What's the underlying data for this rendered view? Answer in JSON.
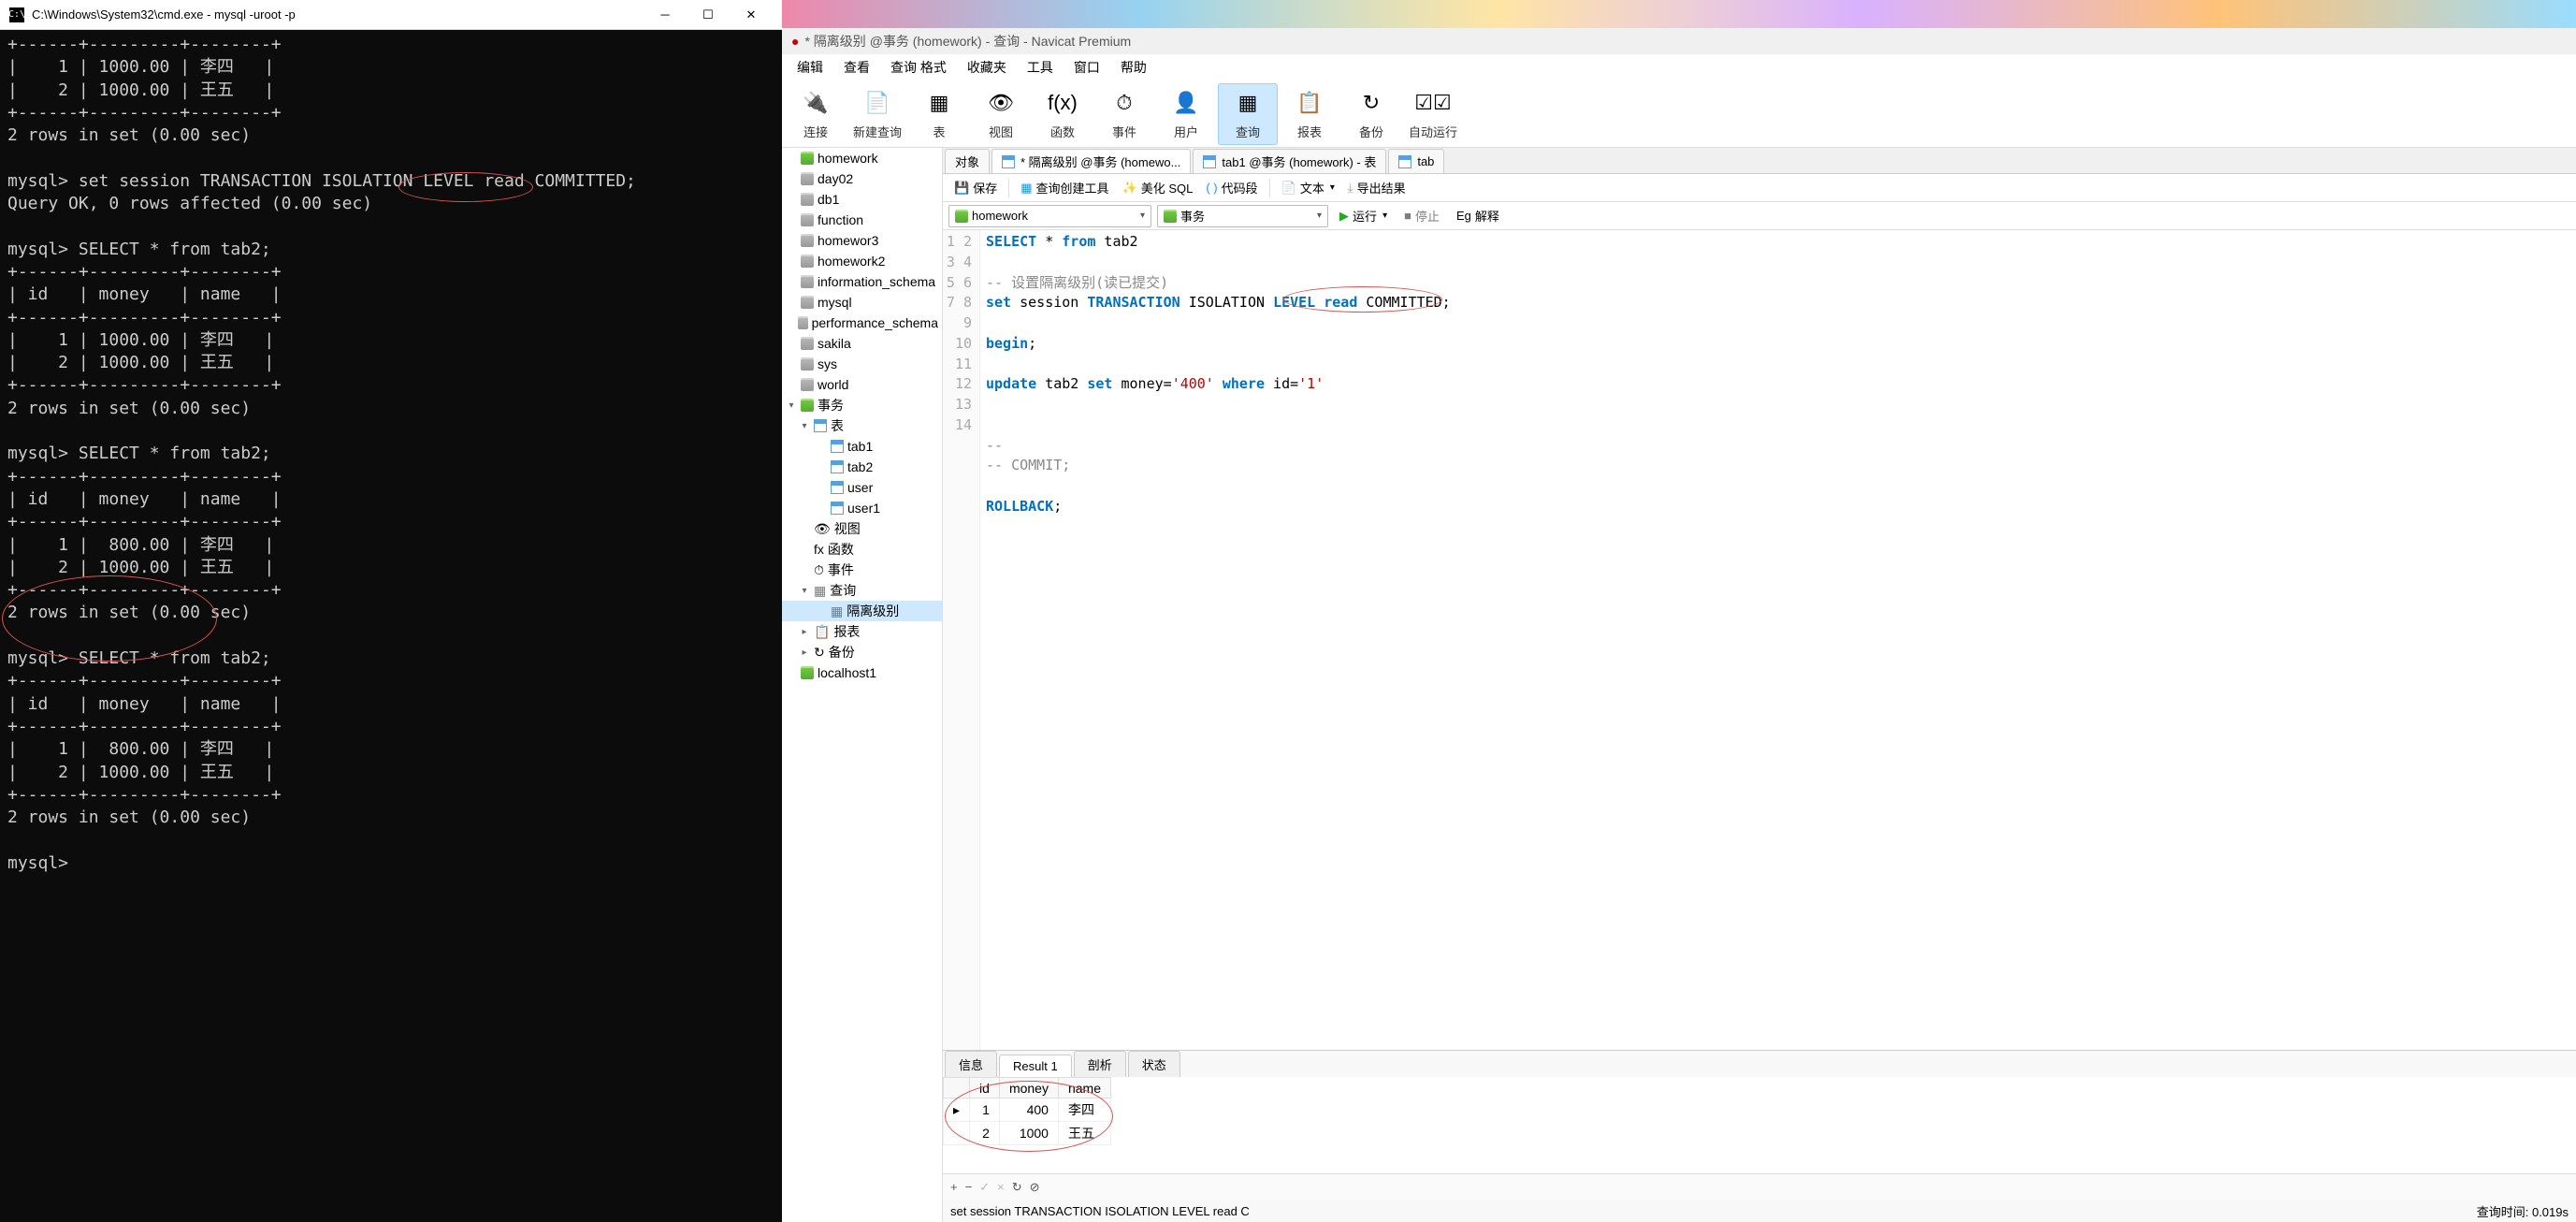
{
  "cmd": {
    "title": "C:\\Windows\\System32\\cmd.exe - mysql  -uroot -p",
    "output": "+------+---------+--------+\n|    1 | 1000.00 | 李四   |\n|    2 | 1000.00 | 王五   |\n+------+---------+--------+\n2 rows in set (0.00 sec)\n\nmysql> set session TRANSACTION ISOLATION LEVEL read COMMITTED;\nQuery OK, 0 rows affected (0.00 sec)\n\nmysql> SELECT * from tab2;\n+------+---------+--------+\n| id   | money   | name   |\n+------+---------+--------+\n|    1 | 1000.00 | 李四   |\n|    2 | 1000.00 | 王五   |\n+------+---------+--------+\n2 rows in set (0.00 sec)\n\nmysql> SELECT * from tab2;\n+------+---------+--------+\n| id   | money   | name   |\n+------+---------+--------+\n|    1 |  800.00 | 李四   |\n|    2 | 1000.00 | 王五   |\n+------+---------+--------+\n2 rows in set (0.00 sec)\n\nmysql> SELECT * from tab2;\n+------+---------+--------+\n| id   | money   | name   |\n+------+---------+--------+\n|    1 |  800.00 | 李四   |\n|    2 | 1000.00 | 王五   |\n+------+---------+--------+\n2 rows in set (0.00 sec)\n\nmysql> "
  },
  "navicat": {
    "title": "* 隔离级别 @事务 (homework) - 查询 - Navicat Premium",
    "menu": [
      "编辑",
      "查看",
      "查询 格式",
      "收藏夹",
      "工具",
      "窗口",
      "帮助"
    ],
    "toolbar": [
      {
        "label": "连接",
        "icon": "🔌"
      },
      {
        "label": "新建查询",
        "icon": "📄"
      },
      {
        "label": "表",
        "icon": "▦"
      },
      {
        "label": "视图",
        "icon": "👁"
      },
      {
        "label": "函数",
        "icon": "f(x)"
      },
      {
        "label": "事件",
        "icon": "⏱"
      },
      {
        "label": "用户",
        "icon": "👤"
      },
      {
        "label": "查询",
        "icon": "▦",
        "sel": true
      },
      {
        "label": "报表",
        "icon": "📋"
      },
      {
        "label": "备份",
        "icon": "↻"
      },
      {
        "label": "自动运行",
        "icon": "☑☑"
      }
    ],
    "sidebar_top": [
      {
        "label": "homework",
        "type": "db-green"
      },
      {
        "label": "day02",
        "type": "db"
      },
      {
        "label": "db1",
        "type": "db"
      },
      {
        "label": "function",
        "type": "db"
      },
      {
        "label": "homewor3",
        "type": "db"
      },
      {
        "label": "homework2",
        "type": "db"
      },
      {
        "label": "information_schema",
        "type": "db"
      },
      {
        "label": "mysql",
        "type": "db"
      },
      {
        "label": "performance_schema",
        "type": "db"
      },
      {
        "label": "sakila",
        "type": "db"
      },
      {
        "label": "sys",
        "type": "db"
      },
      {
        "label": "world",
        "type": "db"
      }
    ],
    "sidebar_shiwu": "事务",
    "sidebar_table_hdr": "表",
    "sidebar_tables": [
      "tab1",
      "tab2",
      "user",
      "user1"
    ],
    "sidebar_extra": [
      {
        "label": "视图",
        "icon": "👁"
      },
      {
        "label": "函数",
        "icon": "fx"
      },
      {
        "label": "事件",
        "icon": "⏱"
      }
    ],
    "sidebar_query_hdr": "查询",
    "sidebar_query_item": "隔离级别",
    "sidebar_bottom": [
      {
        "label": "报表",
        "icon": "📋"
      },
      {
        "label": "备份",
        "icon": "↻"
      }
    ],
    "sidebar_localhost": "localhost1",
    "tabs": [
      {
        "label": "对象",
        "active": false
      },
      {
        "label": "* 隔离级别 @事务 (homewo...",
        "active": true
      },
      {
        "label": "tab1 @事务 (homework) - 表",
        "active": false
      },
      {
        "label": "tab",
        "active": false
      }
    ],
    "subtoolbar": {
      "save": "保存",
      "qbuilder": "查询创建工具",
      "beautify": "美化 SQL",
      "snippet": "代码段",
      "text": "文本",
      "export": "导出结果"
    },
    "combo_db": "homework",
    "combo_schema": "事务",
    "run": "运行",
    "stop": "停止",
    "explain": "解释",
    "sql_lines": [
      {
        "n": 1,
        "html": "<span class='kw'>SELECT</span> * <span class='kw'>from</span> tab2"
      },
      {
        "n": 2,
        "html": ""
      },
      {
        "n": 3,
        "html": "<span class='gray'>-- 设置隔离级别(读已提交)</span>"
      },
      {
        "n": 4,
        "html": "<span class='kw'>set</span> session <span class='kw'>TRANSACTION</span> ISOLATION <span class='kw'>LEVEL</span> <span class='kw'>read</span> COMMITTED;"
      },
      {
        "n": 5,
        "html": ""
      },
      {
        "n": 6,
        "html": "<span class='kw'>begin</span>;"
      },
      {
        "n": 7,
        "html": ""
      },
      {
        "n": 8,
        "html": "<span class='kw'>update</span> tab2 <span class='kw'>set</span> money=<span class='str'>'400'</span> <span class='kw'>where</span> id=<span class='str'>'1'</span>"
      },
      {
        "n": 9,
        "html": ""
      },
      {
        "n": 10,
        "html": ""
      },
      {
        "n": 11,
        "html": "<span class='gray'>-- </span>"
      },
      {
        "n": 12,
        "html": "<span class='gray'>-- COMMIT;</span>"
      },
      {
        "n": 13,
        "html": ""
      },
      {
        "n": 14,
        "html": "<span class='kw'>ROLLBACK</span>;"
      }
    ],
    "result_tabs": [
      "信息",
      "Result 1",
      "剖析",
      "状态"
    ],
    "result_active": 1,
    "result_cols": [
      "id",
      "money",
      "name"
    ],
    "result_rows": [
      {
        "id": "1",
        "money": "400",
        "name": "李四",
        "cur": true
      },
      {
        "id": "2",
        "money": "1000",
        "name": "王五",
        "cur": false
      }
    ],
    "result_tb_icons": [
      "+",
      "−",
      "✓",
      "×",
      "↻",
      "⊘"
    ],
    "status_left": "set session TRANSACTION ISOLATION LEVEL read C",
    "status_right": "查询时间: 0.019s"
  }
}
